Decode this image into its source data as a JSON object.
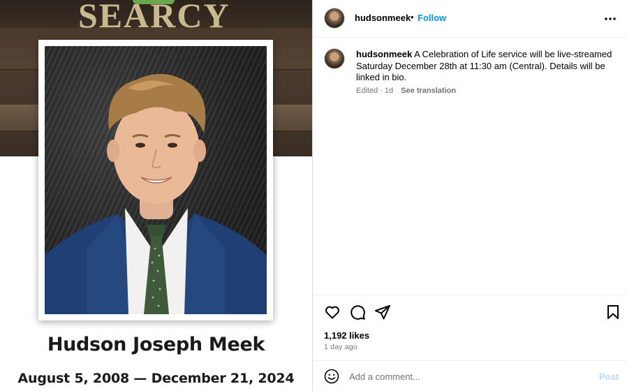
{
  "post_image": {
    "brand": "SEARCY",
    "name": "Hudson Joseph Meek",
    "dates": "August 5, 2008 — December 21, 2024"
  },
  "header": {
    "username": "hudsonmeek",
    "dot": "•",
    "follow_label": "Follow",
    "more_icon": "more-horizontal-icon"
  },
  "caption": {
    "username": "hudsonmeek",
    "text": "A Celebration of Life service will be live-streamed Saturday December 28th at 11:30 am (Central). Details will be linked in bio.",
    "edited_label": "Edited",
    "separator": "·",
    "time": "1d",
    "see_translation": "See translation"
  },
  "actions": {
    "icons": [
      "heart-icon",
      "comment-icon",
      "share-icon",
      "bookmark-icon"
    ],
    "likes": "1,192 likes",
    "posted": "1 day ago"
  },
  "comment": {
    "placeholder": "Add a comment...",
    "post_label": "Post",
    "emoji_icon": "emoji-icon"
  },
  "colors": {
    "accent": "#0095f6",
    "muted": "#737373",
    "post_disabled": "#b3dbff",
    "divider": "#efefef"
  }
}
